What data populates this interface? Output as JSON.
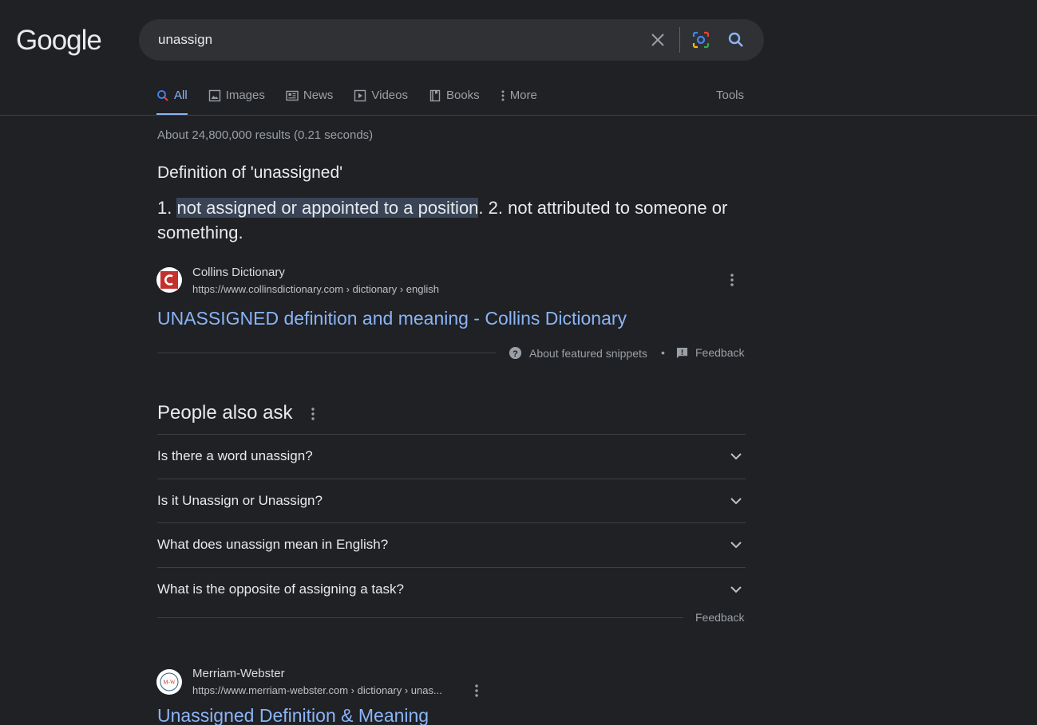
{
  "header": {
    "logo": "Google",
    "search_value": "unassign"
  },
  "tabs": [
    {
      "label": "All",
      "icon": "search-icon",
      "active": true
    },
    {
      "label": "Images",
      "icon": "image-icon"
    },
    {
      "label": "News",
      "icon": "news-icon"
    },
    {
      "label": "Videos",
      "icon": "play-icon"
    },
    {
      "label": "Books",
      "icon": "book-icon"
    },
    {
      "label": "More",
      "icon": "more-vert-icon"
    }
  ],
  "tools_label": "Tools",
  "result_stats": "About 24,800,000 results (0.21 seconds)",
  "featured_snippet": {
    "heading": "Definition of 'unassigned'",
    "prefix": "1. ",
    "highlighted": "not assigned or appointed to a position",
    "rest": ". 2. not attributed to someone or something.",
    "source_name": "Collins Dictionary",
    "source_url": "https://www.collinsdictionary.com › dictionary › english",
    "title": "UNASSIGNED definition and meaning - Collins Dictionary",
    "about_label": "About featured snippets",
    "separator": "•",
    "feedback_label": "Feedback"
  },
  "people_also_ask": {
    "title": "People also ask",
    "questions": [
      "Is there a word unassign?",
      "Is it Unassign or Unassign?",
      "What does unassign mean in English?",
      "What is the opposite of assigning a task?"
    ],
    "feedback_label": "Feedback"
  },
  "result2": {
    "favicon_text": "M-W",
    "source_name": "Merriam-Webster",
    "source_url": "https://www.merriam-webster.com › dictionary › unas...",
    "title": "Unassigned Definition & Meaning"
  },
  "colors": {
    "background": "#202124",
    "link": "#8ab4f8",
    "text": "#e8eaed",
    "muted": "#9aa0a6",
    "highlight": "#394457"
  }
}
